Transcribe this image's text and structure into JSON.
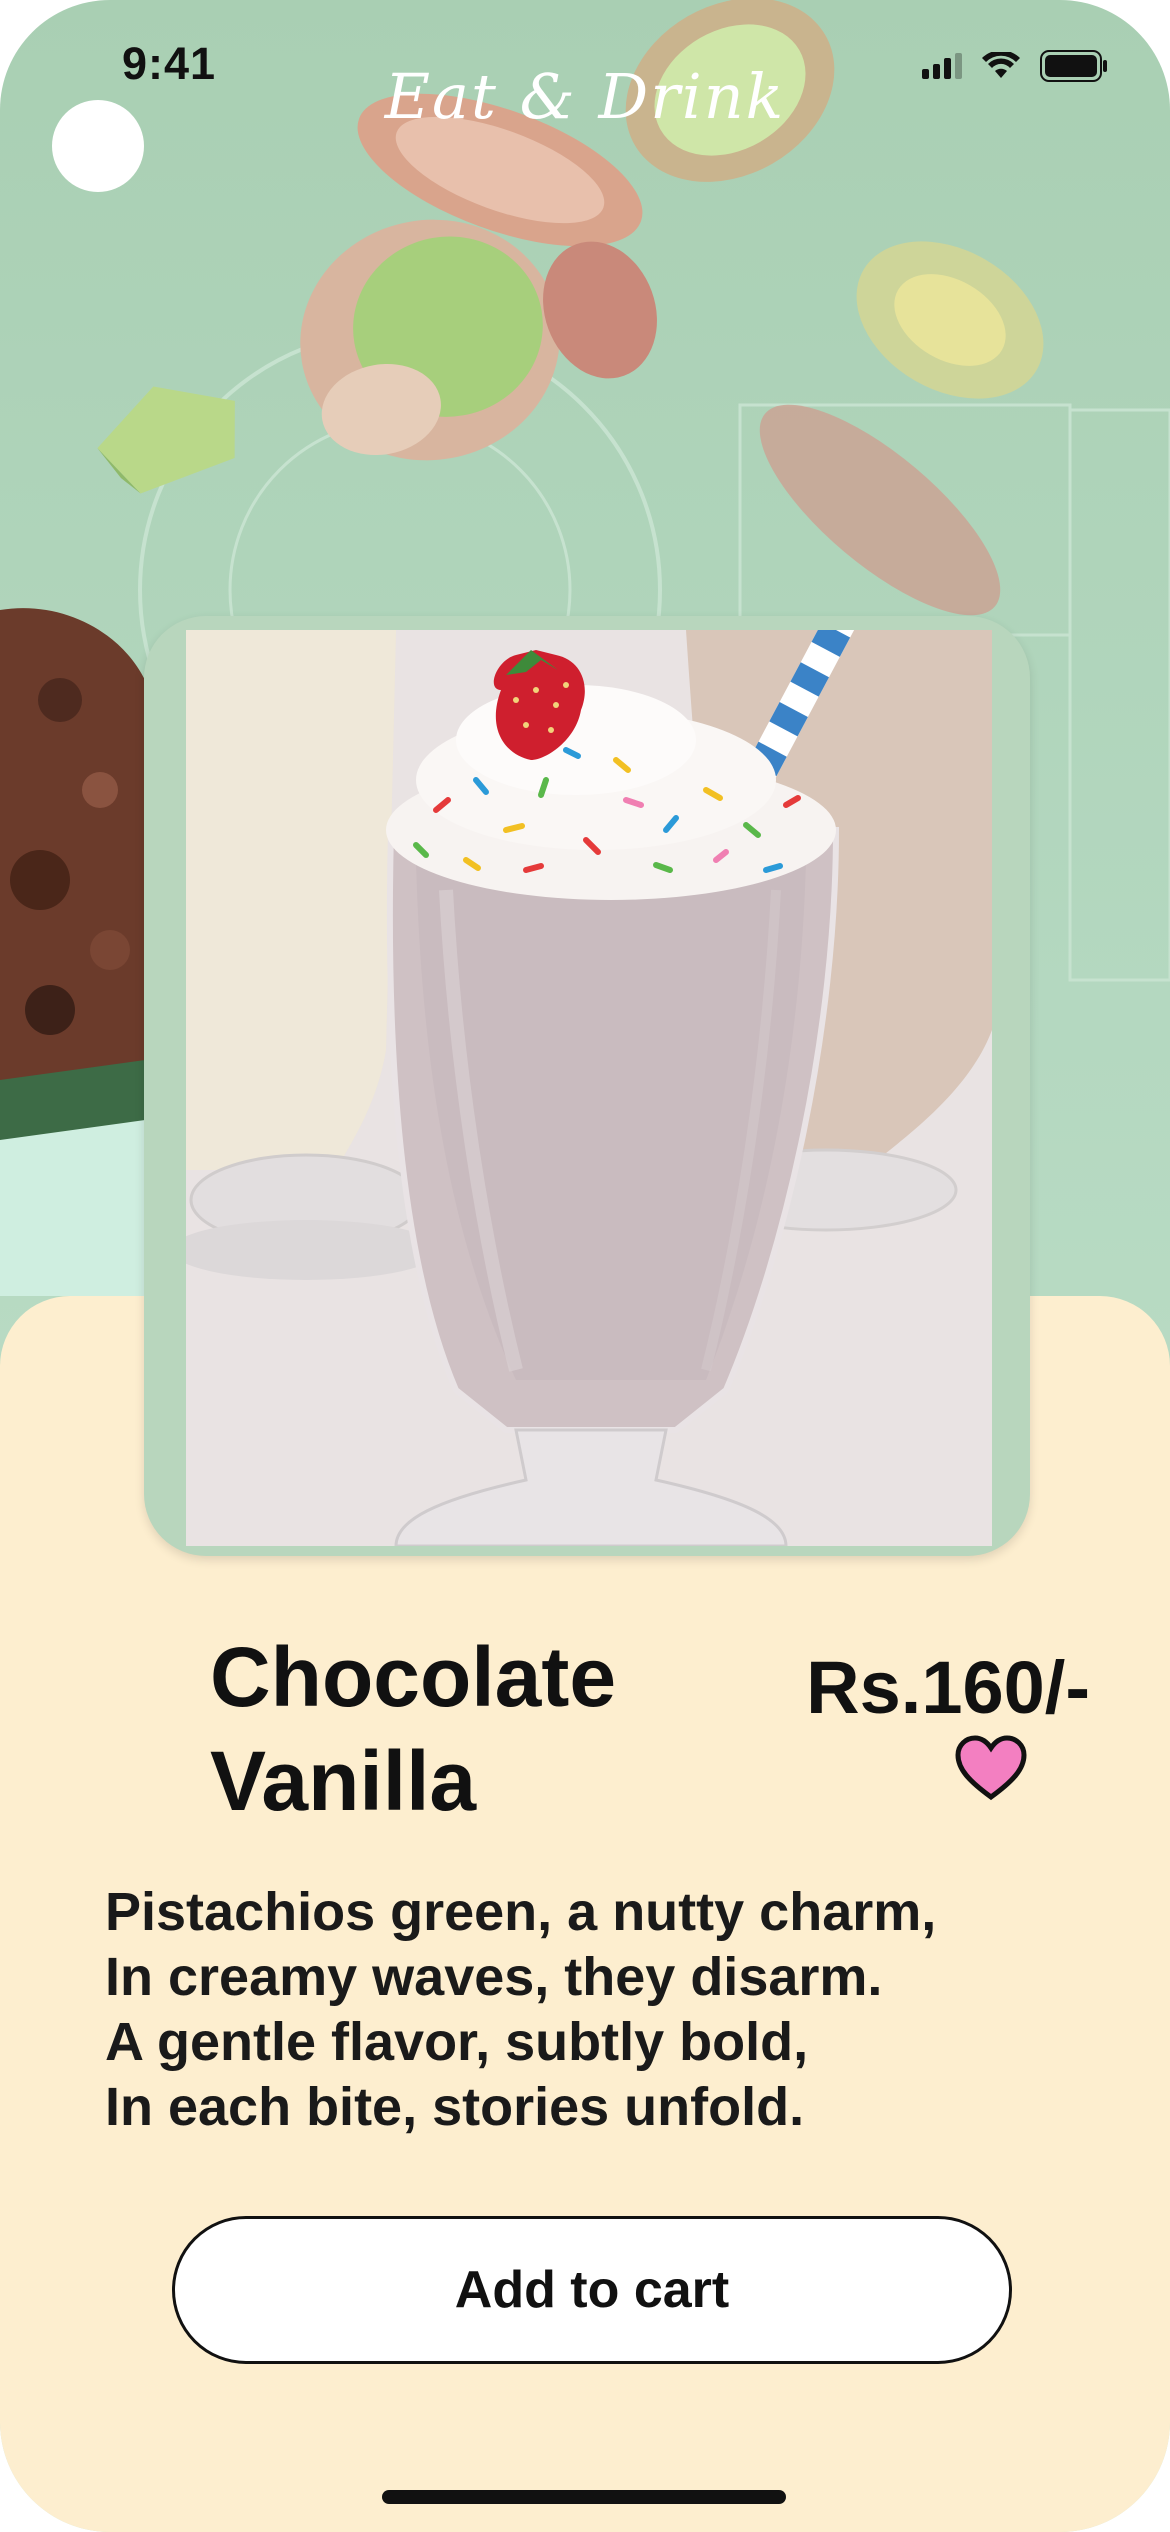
{
  "status_bar": {
    "time": "9:41"
  },
  "header": {
    "brand": "Eat & Drink"
  },
  "product": {
    "name_line1": "Chocolate",
    "name_line2": "Vanilla",
    "price": "Rs.160/-",
    "description": [
      "Pistachios green, a nutty charm,",
      "In creamy waves, they disarm.",
      "A gentle flavor, subtly bold,",
      "In each bite, stories unfold."
    ]
  },
  "actions": {
    "add_to_cart": "Add to cart"
  },
  "colors": {
    "background_green": "#b4d8c0",
    "sheet_cream": "#fdeecf",
    "heart_pink": "#f37fc1"
  }
}
